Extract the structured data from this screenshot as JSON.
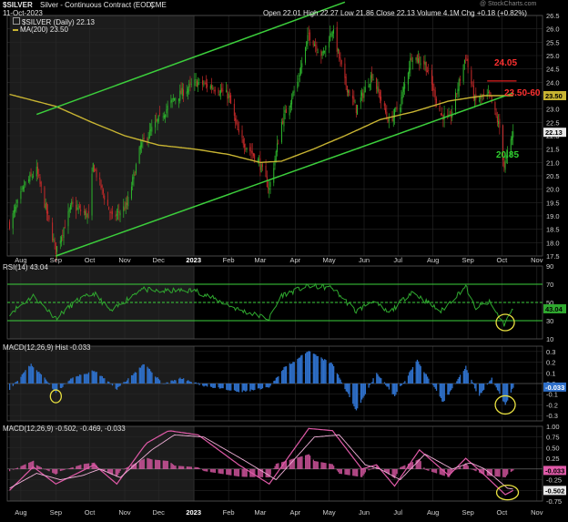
{
  "header": {
    "symbol": "$SILVER",
    "description": "Silver - Continuous Contract (EOD)",
    "exchange": "CME",
    "date": "11-Oct-2023",
    "ohlc": "Open 22.01  High 22.27  Low 21.86  Close 22.13  Volume 4.1M  Chg +0.18 (+0.82%)",
    "watermark": "@ StockCharts.com",
    "legend_price": "$SILVER (Daily) 22.13",
    "legend_ma": "MA(200) 23.50",
    "rsi_label": "RSI(14) 43.04",
    "macd_hist_label": "MACD(12,26,9) Hist -0.033",
    "macd_label": "MACD(12,26,9) -0.502, -0.469, -0.033"
  },
  "colors": {
    "background": "#000000",
    "candle_up": "#2db52d",
    "candle_down": "#c62a2a",
    "ma200": "#c8b432",
    "channel": "#3ccf3c",
    "resistance": "#e02020",
    "rsi_line": "#2fa82f",
    "macd_hist": "#2e6fc8",
    "macd_line": "#e05aa8",
    "signal_line": "#f0b0d8",
    "annotation_circle": "#e8e040",
    "shade": "#1c1c1c"
  },
  "annotations": {
    "resistance_label": "24.05",
    "level_label": "23.50-60",
    "low_label": "20.85"
  },
  "x_axis_labels": [
    "Aug",
    "Sep",
    "Oct",
    "Nov",
    "Dec",
    "2023",
    "Feb",
    "Mar",
    "Apr",
    "May",
    "Jun",
    "Jul",
    "Aug",
    "Sep",
    "Oct",
    "Nov"
  ],
  "chart_data": [
    {
      "type": "candlestick",
      "title": "$SILVER Silver - Continuous Contract (EOD)",
      "ylim": [
        17.5,
        26.5
      ],
      "yticks": [
        "26.5",
        "26.0",
        "25.5",
        "25.0",
        "24.5",
        "24.0",
        "23.5",
        "23.0",
        "22.5",
        "22.0",
        "21.5",
        "21.0",
        "20.5",
        "20.0",
        "19.5",
        "19.0",
        "18.5",
        "18.0",
        "17.5"
      ],
      "price_labels": [
        "23.50",
        "22.13"
      ],
      "close_anchors": [
        [
          "2022-07-22",
          18.7
        ],
        [
          "2022-08-05",
          20.2
        ],
        [
          "2022-08-15",
          20.7
        ],
        [
          "2022-09-01",
          17.7
        ],
        [
          "2022-09-15",
          19.4
        ],
        [
          "2022-09-30",
          19.0
        ],
        [
          "2022-10-04",
          20.9
        ],
        [
          "2022-10-21",
          18.9
        ],
        [
          "2022-11-03",
          19.4
        ],
        [
          "2022-11-15",
          21.6
        ],
        [
          "2022-12-01",
          22.6
        ],
        [
          "2022-12-15",
          23.4
        ],
        [
          "2023-01-03",
          24.0
        ],
        [
          "2023-01-20",
          23.8
        ],
        [
          "2023-02-01",
          23.5
        ],
        [
          "2023-02-10",
          22.0
        ],
        [
          "2023-02-28",
          21.0
        ],
        [
          "2023-03-09",
          20.0
        ],
        [
          "2023-03-20",
          22.5
        ],
        [
          "2023-04-03",
          24.0
        ],
        [
          "2023-04-13",
          25.8
        ],
        [
          "2023-04-25",
          25.0
        ],
        [
          "2023-05-04",
          26.0
        ],
        [
          "2023-05-15",
          24.0
        ],
        [
          "2023-05-25",
          23.0
        ],
        [
          "2023-06-08",
          24.3
        ],
        [
          "2023-06-23",
          22.5
        ],
        [
          "2023-07-03",
          23.2
        ],
        [
          "2023-07-13",
          25.0
        ],
        [
          "2023-07-25",
          24.7
        ],
        [
          "2023-08-08",
          22.8
        ],
        [
          "2023-08-16",
          22.6
        ],
        [
          "2023-08-30",
          25.0
        ],
        [
          "2023-09-07",
          23.3
        ],
        [
          "2023-09-20",
          23.5
        ],
        [
          "2023-09-29",
          22.3
        ],
        [
          "2023-10-03",
          20.85
        ],
        [
          "2023-10-11",
          22.13
        ]
      ],
      "ma200": [
        [
          "2022-07-22",
          23.55
        ],
        [
          "2022-09-01",
          23.1
        ],
        [
          "2022-10-03",
          22.5
        ],
        [
          "2022-11-01",
          22.0
        ],
        [
          "2022-12-01",
          21.65
        ],
        [
          "2023-01-02",
          21.5
        ],
        [
          "2023-02-01",
          21.3
        ],
        [
          "2023-03-01",
          21.0
        ],
        [
          "2023-03-20",
          21.05
        ],
        [
          "2023-04-17",
          21.5
        ],
        [
          "2023-05-15",
          22.0
        ],
        [
          "2023-06-15",
          22.6
        ],
        [
          "2023-07-15",
          22.9
        ],
        [
          "2023-08-15",
          23.3
        ],
        [
          "2023-09-15",
          23.5
        ],
        [
          "2023-10-11",
          23.5
        ]
      ],
      "channel_upper": [
        [
          "2022-08-15",
          22.8
        ],
        [
          "2023-05-15",
          27.0
        ]
      ],
      "channel_lower": [
        [
          "2022-09-01",
          17.5
        ],
        [
          "2023-10-11",
          23.6
        ]
      ],
      "resistance": [
        [
          "2023-09-18",
          24.05
        ],
        [
          "2023-10-14",
          24.05
        ]
      ],
      "shaded_range": [
        "2022-07-22",
        "2023-01-02"
      ]
    },
    {
      "type": "line",
      "title": "RSI(14) 43.04",
      "ylim": [
        10,
        90
      ],
      "yticks": [
        "90",
        "70",
        "50",
        "30",
        "10"
      ],
      "value_label": "43.04",
      "levels": [
        70,
        50,
        30
      ],
      "anchors": [
        [
          "2022-07-22",
          38
        ],
        [
          "2022-08-12",
          57
        ],
        [
          "2022-09-01",
          33
        ],
        [
          "2022-09-20",
          52
        ],
        [
          "2022-10-05",
          60
        ],
        [
          "2022-10-20",
          40
        ],
        [
          "2022-11-15",
          65
        ],
        [
          "2022-12-01",
          62
        ],
        [
          "2022-12-15",
          63
        ],
        [
          "2023-01-03",
          63
        ],
        [
          "2023-02-10",
          42
        ],
        [
          "2023-03-09",
          32
        ],
        [
          "2023-03-20",
          58
        ],
        [
          "2023-04-13",
          68
        ],
        [
          "2023-05-04",
          66
        ],
        [
          "2023-05-25",
          40
        ],
        [
          "2023-06-08",
          52
        ],
        [
          "2023-06-23",
          38
        ],
        [
          "2023-07-13",
          62
        ],
        [
          "2023-08-08",
          40
        ],
        [
          "2023-08-30",
          68
        ],
        [
          "2023-09-07",
          44
        ],
        [
          "2023-09-20",
          50
        ],
        [
          "2023-10-03",
          26
        ],
        [
          "2023-10-11",
          43.04
        ]
      ]
    },
    {
      "type": "bar",
      "title": "MACD(12,26,9) Hist -0.033",
      "ylim": [
        -0.35,
        0.35
      ],
      "yticks": [
        "0.3",
        "0.2",
        "0.1",
        "0.0",
        "-0.1",
        "-0.2",
        "-0.3"
      ],
      "value_label": "-0.033",
      "anchors": [
        [
          "2022-07-22",
          -0.05
        ],
        [
          "2022-08-10",
          0.18
        ],
        [
          "2022-08-22",
          0.05
        ],
        [
          "2022-09-01",
          -0.08
        ],
        [
          "2022-09-15",
          0.05
        ],
        [
          "2022-10-05",
          0.12
        ],
        [
          "2022-10-25",
          -0.05
        ],
        [
          "2022-11-18",
          0.18
        ],
        [
          "2022-12-05",
          0.0
        ],
        [
          "2022-12-20",
          0.05
        ],
        [
          "2023-01-10",
          -0.02
        ],
        [
          "2023-02-10",
          -0.08
        ],
        [
          "2023-03-09",
          -0.04
        ],
        [
          "2023-03-22",
          0.15
        ],
        [
          "2023-04-13",
          0.3
        ],
        [
          "2023-05-04",
          0.18
        ],
        [
          "2023-05-25",
          -0.25
        ],
        [
          "2023-06-12",
          0.1
        ],
        [
          "2023-06-28",
          -0.12
        ],
        [
          "2023-07-18",
          0.22
        ],
        [
          "2023-08-10",
          -0.18
        ],
        [
          "2023-08-30",
          0.16
        ],
        [
          "2023-09-10",
          -0.12
        ],
        [
          "2023-09-22",
          0.05
        ],
        [
          "2023-10-04",
          -0.2
        ],
        [
          "2023-10-11",
          -0.033
        ]
      ]
    },
    {
      "type": "line",
      "title": "MACD(12,26,9) -0.502, -0.469, -0.033",
      "ylim": [
        -0.75,
        1.0
      ],
      "yticks": [
        "1.00",
        "0.75",
        "0.50",
        "0.25",
        "-0.25",
        "-0.50",
        "-0.75"
      ],
      "value_labels": [
        "-0.033",
        "-0.502"
      ],
      "series": [
        {
          "name": "MACD(12,26,9)",
          "anchors": [
            [
              "2022-07-22",
              -0.5
            ],
            [
              "2022-08-12",
              0.05
            ],
            [
              "2022-09-01",
              -0.35
            ],
            [
              "2022-09-20",
              -0.1
            ],
            [
              "2022-10-05",
              0.1
            ],
            [
              "2022-10-25",
              -0.35
            ],
            [
              "2022-11-20",
              0.6
            ],
            [
              "2022-12-10",
              0.9
            ],
            [
              "2023-01-05",
              0.8
            ],
            [
              "2023-02-10",
              0.1
            ],
            [
              "2023-03-09",
              -0.35
            ],
            [
              "2023-04-13",
              0.95
            ],
            [
              "2023-05-04",
              0.9
            ],
            [
              "2023-05-30",
              0.0
            ],
            [
              "2023-06-12",
              0.1
            ],
            [
              "2023-06-28",
              -0.4
            ],
            [
              "2023-07-20",
              0.45
            ],
            [
              "2023-08-15",
              -0.15
            ],
            [
              "2023-08-30",
              0.25
            ],
            [
              "2023-09-12",
              -0.05
            ],
            [
              "2023-10-04",
              -0.6
            ],
            [
              "2023-10-11",
              -0.502
            ]
          ]
        },
        {
          "name": "signal",
          "anchors": [
            [
              "2022-07-22",
              -0.45
            ],
            [
              "2022-08-15",
              -0.1
            ],
            [
              "2022-09-05",
              -0.25
            ],
            [
              "2022-09-25",
              -0.15
            ],
            [
              "2022-10-10",
              0.0
            ],
            [
              "2022-10-28",
              -0.2
            ],
            [
              "2022-11-25",
              0.45
            ],
            [
              "2022-12-15",
              0.8
            ],
            [
              "2023-01-10",
              0.75
            ],
            [
              "2023-02-15",
              0.2
            ],
            [
              "2023-03-15",
              -0.25
            ],
            [
              "2023-04-18",
              0.75
            ],
            [
              "2023-05-10",
              0.8
            ],
            [
              "2023-06-02",
              0.1
            ],
            [
              "2023-06-15",
              0.0
            ],
            [
              "2023-07-03",
              -0.25
            ],
            [
              "2023-07-25",
              0.35
            ],
            [
              "2023-08-18",
              0.0
            ],
            [
              "2023-09-03",
              0.15
            ],
            [
              "2023-09-16",
              0.0
            ],
            [
              "2023-10-06",
              -0.45
            ],
            [
              "2023-10-11",
              -0.469
            ]
          ]
        }
      ]
    }
  ]
}
